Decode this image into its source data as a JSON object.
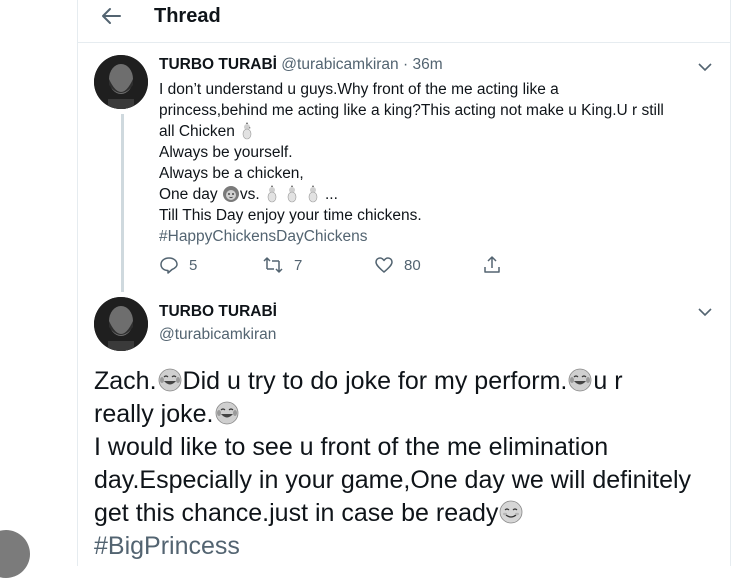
{
  "header": {
    "title": "Thread",
    "back_icon": "arrow-left-icon"
  },
  "tweet1": {
    "name": "TURBO TURABİ",
    "handle": "@turabicamkiran",
    "separator": "·",
    "time": "36m",
    "lines": [
      "I don’t understand u guys.Why front of the me acting like a",
      "princess,behind me acting like a king?This acting not make u King.U r still",
      "all Chicken",
      "Always be yourself.",
      "Always be a chicken,",
      "One day",
      "vs.",
      "...",
      "Till This Day enjoy your time chickens."
    ],
    "hashtag": "#HappyChickensDayChickens",
    "replies": "5",
    "retweets": "7",
    "likes": "80"
  },
  "tweet2": {
    "name": "TURBO TURABİ",
    "handle": "@turabicamkiran",
    "body": [
      "Zach.",
      "Did u try to do joke for my perform.",
      "u r",
      "really joke.",
      "I would like to see u front of the me elimination",
      "day.Especially in your game,One day we will definitely",
      "get this chance.just in case be ready"
    ],
    "hashtag": "#BigPrincess"
  }
}
